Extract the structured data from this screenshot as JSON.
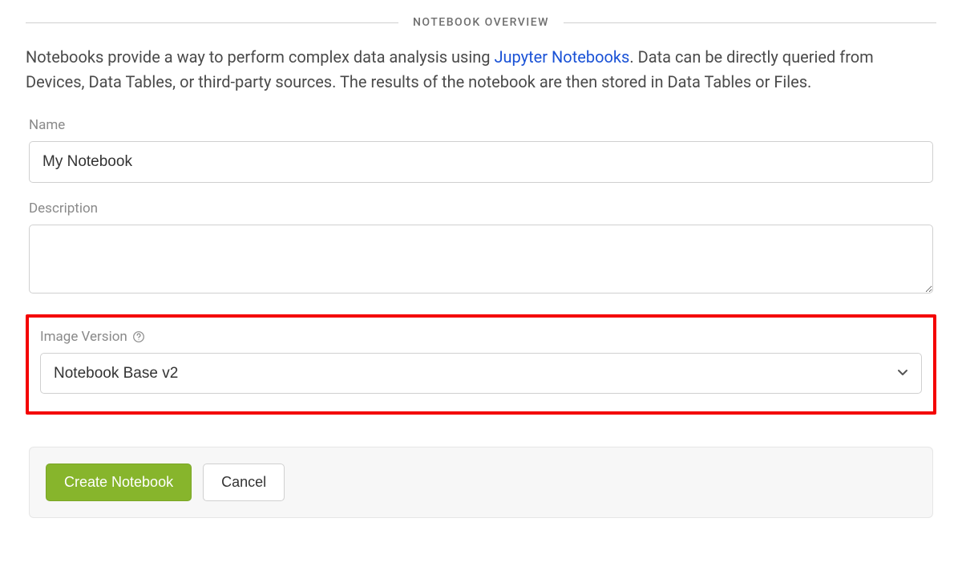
{
  "section_title": "NOTEBOOK OVERVIEW",
  "intro": {
    "before_link": "Notebooks provide a way to perform complex data analysis using ",
    "link_text": "Jupyter Notebooks",
    "after_link": ". Data can be directly queried from Devices, Data Tables, or third-party sources. The results of the notebook are then stored in Data Tables or Files."
  },
  "fields": {
    "name": {
      "label": "Name",
      "value": "My Notebook"
    },
    "description": {
      "label": "Description",
      "value": ""
    },
    "image_version": {
      "label": "Image Version",
      "selected": "Notebook Base v2"
    }
  },
  "buttons": {
    "create": "Create Notebook",
    "cancel": "Cancel"
  }
}
